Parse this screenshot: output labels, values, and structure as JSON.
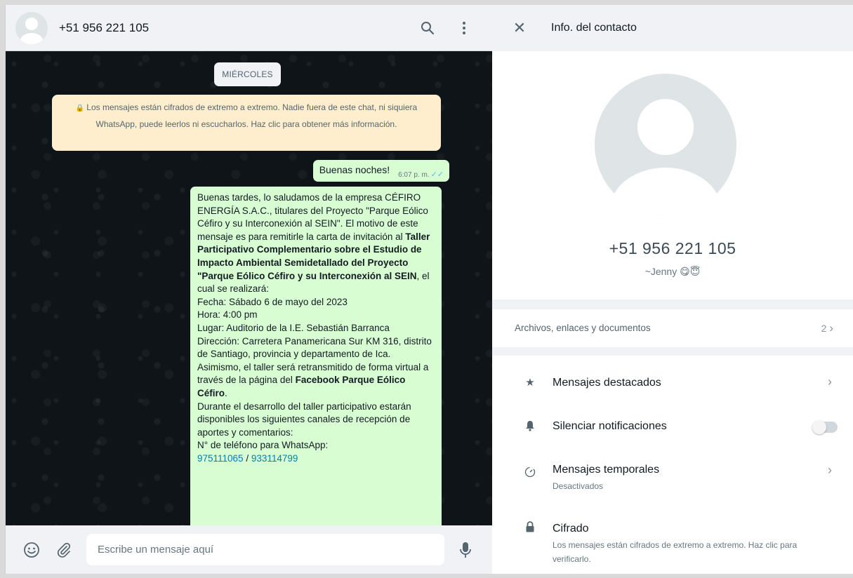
{
  "chat": {
    "header": {
      "title": "+51 956 221 105"
    },
    "date_label": "MIÉRCOLES",
    "encryption_notice": "Los mensajes están cifrados de extremo a extremo. Nadie fuera de este chat, ni siquiera WhatsApp, puede leerlos ni escucharlos. Haz clic para obtener más información.",
    "messages": [
      {
        "text": "Buenas noches!",
        "time": "6:07 p. m."
      }
    ],
    "long_message": {
      "p1": "Buenas tardes, lo saludamos de la empresa CÉFIRO ENERGÍA S.A.C., titulares del Proyecto \"Parque Eólico Céfiro y su Interconexión al SEIN\". El motivo de este mensaje es para remitirle la carta de invitación al ",
      "p1_bold": "Taller Participativo Complementario sobre el Estudio de Impacto Ambiental Semidetallado del Proyecto \"Parque Eólico Céfiro y su Interconexión al SEIN",
      "p1_end": ", el cual se realizará:",
      "fecha": "Fecha: Sábado 6 de mayo del 2023",
      "hora": "Hora: 4:00 pm",
      "lugar": "Lugar:  Auditorio de la I.E. Sebastián Barranca",
      "direccion": "Dirección: Carretera Panamericana Sur KM 316, distrito de Santiago, provincia y departamento de Ica.",
      "p2": "Asimismo, el taller será retransmitido de forma virtual a través de la página del ",
      "p2_bold": "Facebook Parque Eólico Céfiro",
      "p2_end": ".",
      "p3": "Durante el desarrollo del taller participativo estarán disponibles los siguientes canales de recepción de aportes y comentarios:",
      "p4": "N° de teléfono para WhatsApp:",
      "phone1": "975111065",
      "phone_sep": " / ",
      "phone2": "933114799"
    },
    "composer": {
      "placeholder": "Escribe un mensaje aquí"
    }
  },
  "contact_info": {
    "title": "Info. del contacto",
    "phone": "+51 956 221 105",
    "name": "~Jenny 😋😇",
    "media": {
      "label": "Archivos, enlaces y documentos",
      "count": "2"
    },
    "actions": [
      {
        "label": "Mensajes destacados"
      },
      {
        "label": "Silenciar notificaciones",
        "toggle": false
      },
      {
        "label": "Mensajes temporales",
        "sub": "Desactivados"
      },
      {
        "label": "Cifrado",
        "sub": "Los mensajes están cifrados de extremo a extremo. Haz clic para verificarlo."
      }
    ]
  },
  "colors": {
    "outgoing_bubble": "#d9fdd3",
    "notice_bg": "#ffeecd",
    "link": "#027eb5",
    "read_ticks": "#53bdeb"
  }
}
